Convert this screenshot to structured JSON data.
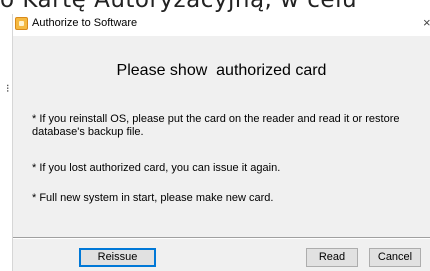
{
  "background": {
    "text": "o Kartę Autoryzacyjną, w celu",
    "mark": "⁝"
  },
  "window": {
    "title": "Authorize to Software",
    "close_glyph": "×"
  },
  "heading": "Please show  authorized card",
  "messages": [
    "* If you reinstall OS, please put the card on the reader and read it or restore database's backup file.",
    "* If you lost authorized card, you can issue it again.",
    "* Full new system in start, please make new card."
  ],
  "buttons": {
    "reissue": "Reissue",
    "read": "Read",
    "cancel": "Cancel"
  },
  "colors": {
    "dialog_bg": "#f0f0f0",
    "focus_border": "#0078d7",
    "app_icon": "#f5b941"
  }
}
